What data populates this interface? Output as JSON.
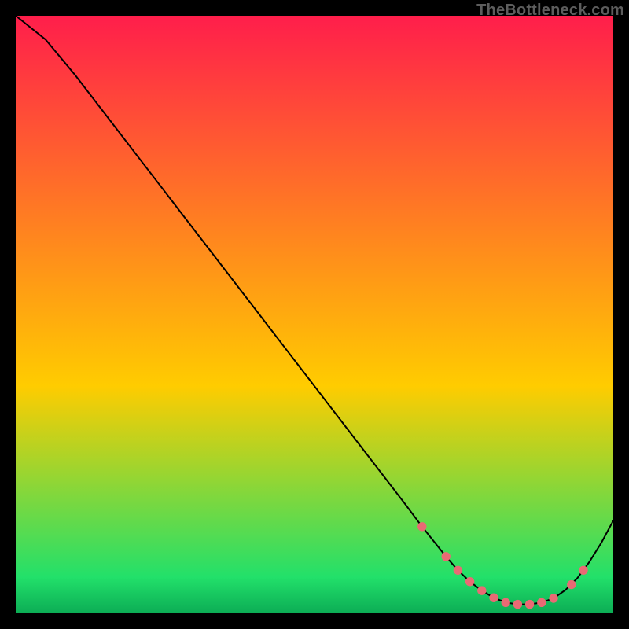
{
  "watermark": "TheBottleneck.com",
  "colors": {
    "gradient_top": "#ff1e4b",
    "gradient_mid": "#ffcc00",
    "gradient_green": "#22e06a",
    "gradient_bottom": "#0cad55",
    "curve": "#000000",
    "marker": "#e96a74",
    "background": "#000000"
  },
  "chart_data": {
    "type": "line",
    "title": "",
    "xlabel": "",
    "ylabel": "",
    "xlim": [
      0,
      100
    ],
    "ylim": [
      0,
      100
    ],
    "grid": false,
    "series": [
      {
        "name": "bottleneck-curve",
        "x": [
          0,
          5,
          10,
          15,
          20,
          25,
          30,
          35,
          40,
          45,
          50,
          55,
          60,
          65,
          68,
          70,
          72,
          74,
          76,
          78,
          80,
          82,
          84,
          86,
          88,
          90,
          92,
          94,
          96,
          98,
          100
        ],
        "y": [
          100,
          96,
          90,
          83.5,
          77,
          70.5,
          64,
          57.5,
          51,
          44.5,
          38,
          31.5,
          25,
          18.5,
          14.5,
          12,
          9.5,
          7.2,
          5.3,
          3.8,
          2.6,
          1.8,
          1.5,
          1.5,
          1.8,
          2.5,
          3.9,
          5.9,
          8.6,
          11.8,
          15.5
        ]
      },
      {
        "name": "highlight-markers",
        "x": [
          68,
          72,
          74,
          76,
          78,
          80,
          82,
          84,
          86,
          88,
          90,
          93,
          95
        ],
        "y": [
          14.5,
          9.5,
          7.2,
          5.3,
          3.8,
          2.6,
          1.8,
          1.5,
          1.5,
          1.8,
          2.5,
          4.8,
          7.2
        ]
      }
    ]
  }
}
